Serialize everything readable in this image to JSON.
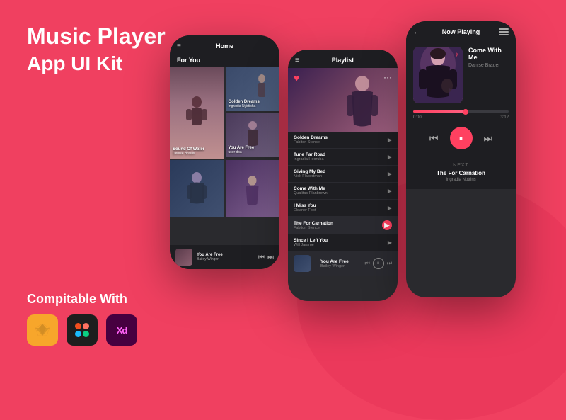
{
  "app": {
    "title": "Music Player",
    "subtitle": "App UI Kit",
    "compatible_label": "Compitable With"
  },
  "phone1": {
    "header_title": "Home",
    "section_label": "For You",
    "tracks": [
      {
        "name": "Sound Of Water",
        "artist": "Denise Brauer"
      },
      {
        "name": "Golden Dreams",
        "artist": "Ingradia Nyirtisha"
      },
      {
        "name": "You Are Free",
        "artist": "user dsa"
      },
      {
        "name": "You Are Free",
        "artist": "Bailey Winger"
      }
    ]
  },
  "phone2": {
    "header_title": "Playlist",
    "tracks": [
      {
        "name": "Golden Dreams",
        "artist": "Fabiton Stence",
        "active": false
      },
      {
        "name": "Tune Far Road",
        "artist": "Ingradia Heoruba",
        "active": false
      },
      {
        "name": "Giving My Bed",
        "artist": "Nick Flabertman",
        "active": false
      },
      {
        "name": "Come With Me",
        "artist": "Qualitas Planbrown",
        "active": false
      },
      {
        "name": "I Miss You",
        "artist": "Eleanor Foot",
        "active": false
      },
      {
        "name": "The For Carnation",
        "artist": "Fabiton Stence",
        "active": true
      },
      {
        "name": "Since I Left You",
        "artist": "Will Jarame",
        "active": false
      },
      {
        "name": "You Are Free",
        "artist": "Bailey Winger",
        "active": false
      }
    ]
  },
  "phone3": {
    "header_title": "Now Playing",
    "track_name": "Come With Me",
    "artist_name": "Danise Brauer",
    "time_current": "0:00",
    "time_total": "3:12",
    "progress_pct": 55,
    "next_label": "NEXT",
    "next_track": "The For Carnation",
    "next_artist": "Ingradia Notrins"
  },
  "tools": [
    {
      "name": "Sketch",
      "icon": "sketch-icon"
    },
    {
      "name": "Figma",
      "icon": "figma-icon"
    },
    {
      "name": "XD",
      "icon": "xd-icon"
    }
  ],
  "colors": {
    "background": "#f04060",
    "phone_bg": "#2a2a2e",
    "header_bg": "#1e1e22",
    "accent": "#ff4060",
    "text_primary": "#ffffff",
    "text_secondary": "#888888"
  }
}
